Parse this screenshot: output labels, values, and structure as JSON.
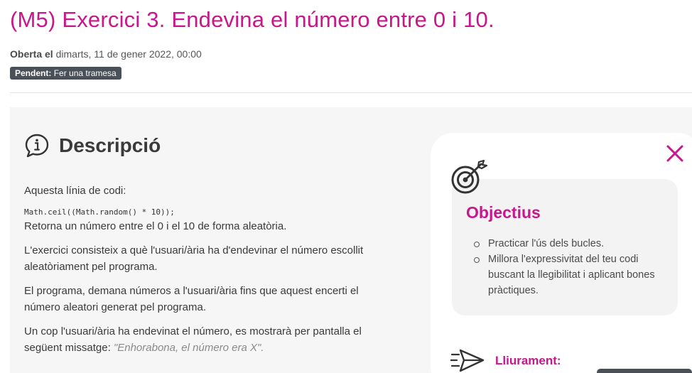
{
  "page": {
    "title": "(M5) Exercici 3. Endevina el número entre 0 i 10.",
    "opened_label": "Oberta el",
    "opened_date": "dimarts, 11 de gener 2022, 00:00",
    "status_label": "Pendent:",
    "status_value": "Fer una tramesa"
  },
  "description": {
    "title": "Descripció",
    "intro": "Aquesta línia de codi:",
    "code": "Math.ceil((Math.random() * 10));",
    "p1": "Retorna un número entre el 0 i el 10 de forma aleatòria.",
    "p2": "L'exercici consisteix a què l'usuari/ària ha d'endevinar el número escollit aleatòriament pel programa.",
    "p3": "El programa, demana números a l'usuari/ària fins que aquest encerti el número aleatori generat pel programa.",
    "p4_text": "Un cop l'usuari/ària ha endevinat el número, es mostrarà per pantalla el següent missatge: ",
    "p4_quote": "\"Enhorabona, el número era X\"."
  },
  "drawer": {
    "objective_title": "Objectius",
    "objectives": [
      "Practicar l'ús dels bucles.",
      "Millora l'expressivitat del teu codi buscant la llegibilitat i aplicant bones pràctiques."
    ],
    "delivery_label": "Lliurament:"
  },
  "colors": {
    "accent": "#c8168b",
    "badge": "#495057",
    "panel": "#f6f6f6"
  },
  "icons": {
    "description": "info-speech-bubble-icon",
    "close": "close-icon",
    "objective": "target-arrow-icon",
    "delivery": "paper-plane-icon"
  }
}
